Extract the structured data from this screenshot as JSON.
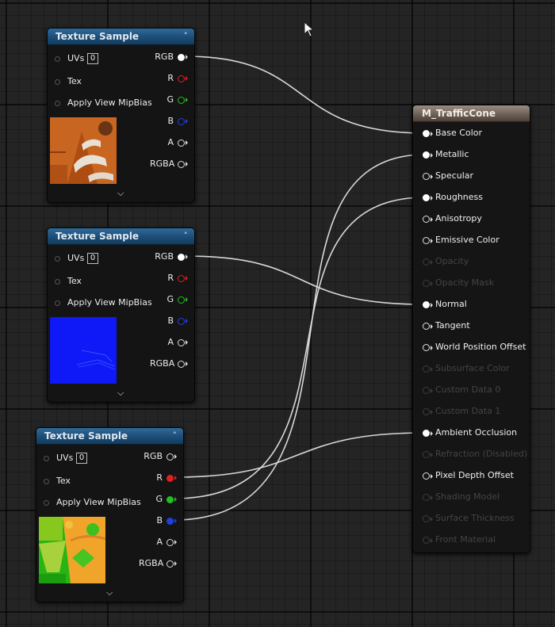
{
  "texture_nodes": [
    {
      "title": "Texture Sample",
      "inputs": {
        "uvs": "UVs",
        "uv_value": "0",
        "tex": "Tex",
        "mipbias": "Apply View MipBias"
      },
      "outputs": {
        "rgb": "RGB",
        "r": "R",
        "g": "G",
        "b": "B",
        "a": "A",
        "rgba": "RGBA"
      },
      "thumbnail": "orange-traffic-cone-albedo",
      "connected": [
        "RGB"
      ]
    },
    {
      "title": "Texture Sample",
      "inputs": {
        "uvs": "UVs",
        "uv_value": "0",
        "tex": "Tex",
        "mipbias": "Apply View MipBias"
      },
      "outputs": {
        "rgb": "RGB",
        "r": "R",
        "g": "G",
        "b": "B",
        "a": "A",
        "rgba": "RGBA"
      },
      "thumbnail": "blue-normal-map",
      "connected": [
        "RGB"
      ]
    },
    {
      "title": "Texture Sample",
      "inputs": {
        "uvs": "UVs",
        "uv_value": "0",
        "tex": "Tex",
        "mipbias": "Apply View MipBias"
      },
      "outputs": {
        "rgb": "RGB",
        "r": "R",
        "g": "G",
        "b": "B",
        "a": "A",
        "rgba": "RGBA"
      },
      "thumbnail": "green-orange-orm-map",
      "connected": [
        "R",
        "G",
        "B"
      ]
    }
  ],
  "material": {
    "title": "M_TrafficCone",
    "pins": [
      {
        "label": "Base Color",
        "enabled": true,
        "connected": true
      },
      {
        "label": "Metallic",
        "enabled": true,
        "connected": true
      },
      {
        "label": "Specular",
        "enabled": true,
        "connected": false
      },
      {
        "label": "Roughness",
        "enabled": true,
        "connected": true
      },
      {
        "label": "Anisotropy",
        "enabled": true,
        "connected": false
      },
      {
        "label": "Emissive Color",
        "enabled": true,
        "connected": false
      },
      {
        "label": "Opacity",
        "enabled": false,
        "connected": false
      },
      {
        "label": "Opacity Mask",
        "enabled": false,
        "connected": false
      },
      {
        "label": "Normal",
        "enabled": true,
        "connected": true
      },
      {
        "label": "Tangent",
        "enabled": true,
        "connected": false
      },
      {
        "label": "World Position Offset",
        "enabled": true,
        "connected": false
      },
      {
        "label": "Subsurface Color",
        "enabled": false,
        "connected": false
      },
      {
        "label": "Custom Data 0",
        "enabled": false,
        "connected": false
      },
      {
        "label": "Custom Data 1",
        "enabled": false,
        "connected": false
      },
      {
        "label": "Ambient Occlusion",
        "enabled": true,
        "connected": true
      },
      {
        "label": "Refraction (Disabled)",
        "enabled": false,
        "connected": false
      },
      {
        "label": "Pixel Depth Offset",
        "enabled": true,
        "connected": false
      },
      {
        "label": "Shading Model",
        "enabled": false,
        "connected": false
      },
      {
        "label": "Surface Thickness",
        "enabled": false,
        "connected": false
      },
      {
        "label": "Front Material",
        "enabled": false,
        "connected": false
      }
    ]
  },
  "connections": [
    {
      "from": "node1.RGB",
      "to": "Base Color"
    },
    {
      "from": "node2.RGB",
      "to": "Normal"
    },
    {
      "from": "node3.R",
      "to": "Ambient Occlusion"
    },
    {
      "from": "node3.G",
      "to": "Roughness"
    },
    {
      "from": "node3.B",
      "to": "Metallic"
    }
  ],
  "colors": {
    "pin_red": "#e02020",
    "pin_green": "#20c020",
    "pin_blue": "#2040e0",
    "pin_white": "#ffffff",
    "wire": "#d8d8d8",
    "texture_header": "#1d4d76",
    "material_header": "#6f6357"
  }
}
